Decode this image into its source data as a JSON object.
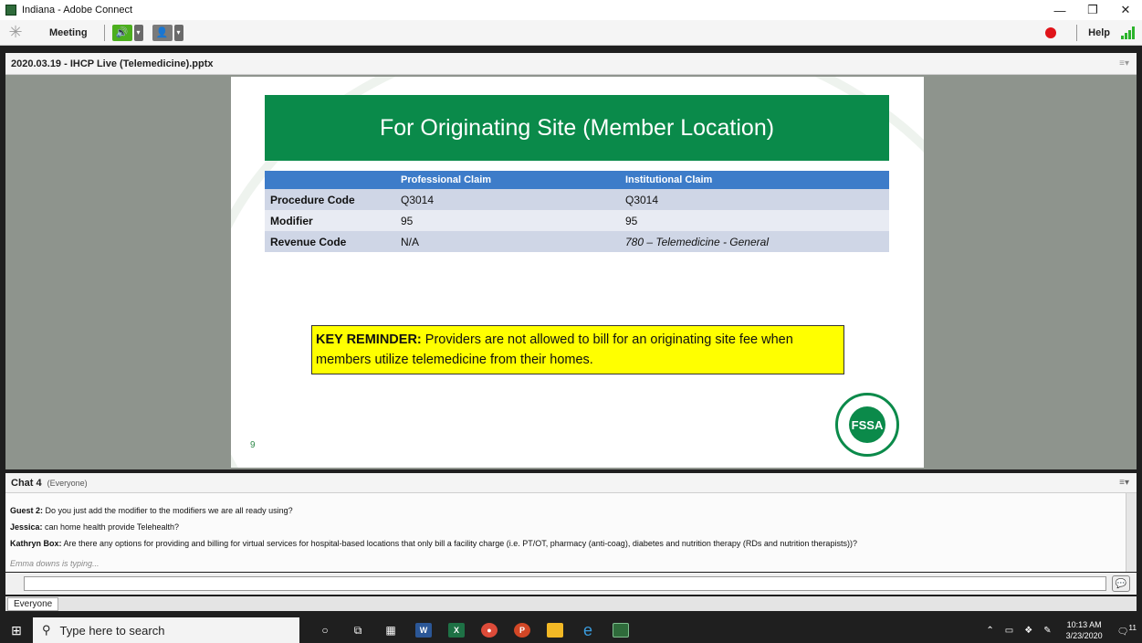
{
  "window": {
    "title": "Indiana - Adobe Connect",
    "minimize": "—",
    "maximize": "❐",
    "close": "✕"
  },
  "menubar": {
    "meeting_label": "Meeting",
    "help_label": "Help"
  },
  "share_pod": {
    "title": "2020.03.19 - IHCP Live (Telemedicine).pptx",
    "menu_icon": "≡▾"
  },
  "slide": {
    "title": "For Originating Site (Member Location)",
    "table_headers": [
      "",
      "Professional Claim",
      "Institutional Claim"
    ],
    "rows": [
      {
        "label": "Procedure Code",
        "professional": "Q3014",
        "institutional": "Q3014"
      },
      {
        "label": "Modifier",
        "professional": "95",
        "institutional": "95"
      },
      {
        "label": "Revenue Code",
        "professional": "N/A",
        "institutional": "780 – Telemedicine - General"
      }
    ],
    "reminder_lead": "KEY REMINDER:",
    "reminder_text": " Providers are not allowed to bill for an originating site fee when members utilize telemedicine from their homes.",
    "page_number": "9",
    "seal_text": "FSSA"
  },
  "chat": {
    "title": "Chat 4",
    "audience": "(Everyone)",
    "messages": [
      {
        "sender": "Guest 2:",
        "text": " Do you just add the modifier to the modifiers we are all ready using?"
      },
      {
        "sender": "Jessica:",
        "text": " can home health provide Telehealth?"
      },
      {
        "sender": "Kathryn Box:",
        "text": " Are there any options for providing and billing for virtual services for hospital-based locations that only bill a facility charge (i.e. PT/OT, pharmacy (anti-coag), diabetes and nutrition therapy (RDs and nutrition therapists))?"
      }
    ],
    "typing": "Emma downs is typing...",
    "input_value": "",
    "tab_label": "Everyone"
  },
  "taskbar": {
    "search_placeholder": "Type here to search",
    "time": "10:13 AM",
    "date": "3/23/2020",
    "notification_count": "11"
  }
}
